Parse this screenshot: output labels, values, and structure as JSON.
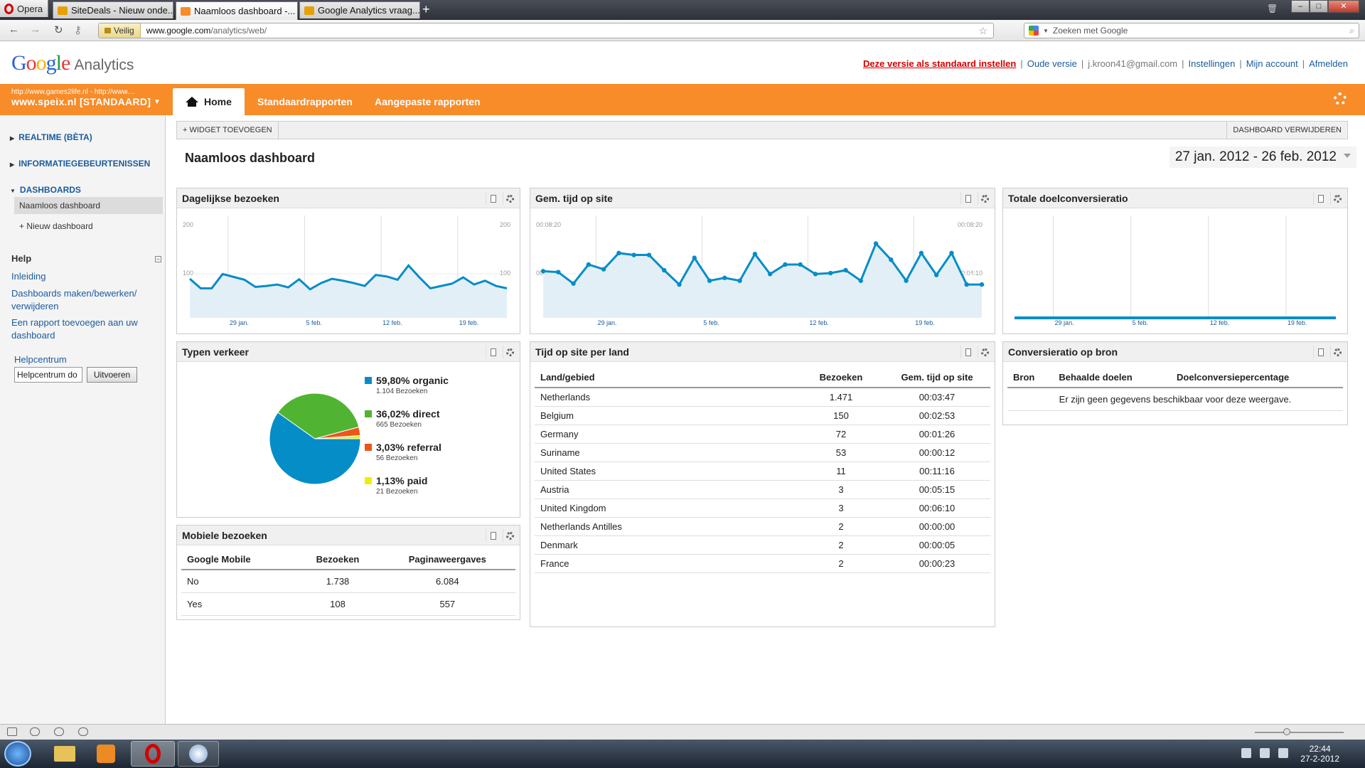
{
  "browser": {
    "menu_label": "Opera",
    "tabs": [
      {
        "label": "SiteDeals - Nieuw onde...",
        "favicon_color": "#e8a000"
      },
      {
        "label": "Naamloos dashboard -...",
        "favicon_color": "#f78c29"
      },
      {
        "label": "Google Analytics vraag...",
        "favicon_color": "#e8a000"
      }
    ],
    "secure_label": "Veilig",
    "url_prefix": "www.google.com",
    "url_path": "/analytics/web/",
    "search_placeholder": "Zoeken met Google"
  },
  "header": {
    "logo_google": "Google",
    "logo_analytics": "Analytics",
    "links": {
      "default_version": "Deze versie als standaard instellen",
      "old_version": "Oude versie",
      "email": "j.kroon41@gmail.com",
      "settings": "Instellingen",
      "account": "Mijn account",
      "logout": "Afmelden"
    }
  },
  "account": {
    "small": "http://www.games2life.nl - http://www....",
    "name": "www.speix.nl [STANDAARD]"
  },
  "nav": {
    "home": "Home",
    "standard_reports": "Standaardrapporten",
    "custom_reports": "Aangepaste rapporten"
  },
  "sidebar": {
    "realtime": "REALTIME (BÈTA)",
    "info_events": "INFORMATIEGEBEURTENISSEN",
    "dashboards": "DASHBOARDS",
    "current_dashboard": "Naamloos dashboard",
    "new_dashboard": "+ Nieuw dashboard",
    "help": "Help",
    "help_links": [
      "Inleiding",
      "Dashboards maken/bewerken/ verwijderen",
      "Een rapport toevoegen aan uw dashboard"
    ],
    "helpcenter_label": "Helpcentrum",
    "helpcenter_input": "Helpcentrum do",
    "helpcenter_button": "Uitvoeren"
  },
  "toolbar": {
    "add_widget": "+ WIDGET TOEVOEGEN",
    "delete_dashboard": "DASHBOARD VERWIJDEREN"
  },
  "dashboard": {
    "title": "Naamloos dashboard",
    "date_range": "27 jan. 2012 - 26 feb. 2012"
  },
  "widgets": {
    "daily_visits": {
      "title": "Dagelijkse bezoeken",
      "ytick_top": "200",
      "ytick_mid": "100"
    },
    "avg_time": {
      "title": "Gem. tijd op site",
      "ytick_top": "00:08:20",
      "ytick_mid": "00:04:10"
    },
    "goal_conv": {
      "title": "Totale doelconversieratio"
    },
    "traffic": {
      "title": "Typen verkeer",
      "items": [
        {
          "pct": "59,80% organic",
          "sub": "1.104 Bezoeken"
        },
        {
          "pct": "36,02% direct",
          "sub": "665 Bezoeken"
        },
        {
          "pct": "3,03% referral",
          "sub": "56 Bezoeken"
        },
        {
          "pct": "1,13% paid",
          "sub": "21 Bezoeken"
        }
      ]
    },
    "mobile": {
      "title": "Mobiele bezoeken",
      "headers": [
        "Google Mobile",
        "Bezoeken",
        "Paginaweergaves"
      ],
      "rows": [
        [
          "No",
          "1.738",
          "6.084"
        ],
        [
          "Yes",
          "108",
          "557"
        ]
      ]
    },
    "country": {
      "title": "Tijd op site per land",
      "headers": [
        "Land/gebied",
        "Bezoeken",
        "Gem. tijd op site"
      ],
      "rows": [
        [
          "Netherlands",
          "1.471",
          "00:03:47"
        ],
        [
          "Belgium",
          "150",
          "00:02:53"
        ],
        [
          "Germany",
          "72",
          "00:01:26"
        ],
        [
          "Suriname",
          "53",
          "00:00:12"
        ],
        [
          "United States",
          "11",
          "00:11:16"
        ],
        [
          "Austria",
          "3",
          "00:05:15"
        ],
        [
          "United Kingdom",
          "3",
          "00:06:10"
        ],
        [
          "Netherlands Antilles",
          "2",
          "00:00:00"
        ],
        [
          "Denmark",
          "2",
          "00:00:05"
        ],
        [
          "France",
          "2",
          "00:00:23"
        ]
      ]
    },
    "conv_source": {
      "title": "Conversieratio op bron",
      "headers": [
        "Bron",
        "Behaalde doelen",
        "Doelconversiepercentage"
      ],
      "empty": "Er zijn geen gegevens beschikbaar voor deze weergave."
    }
  },
  "colors": {
    "accent": "#f78c29",
    "line": "#058dc7",
    "organic": "#058dc7",
    "direct": "#50b432",
    "referral": "#ed561b",
    "paid": "#edef00"
  },
  "chart_data": [
    {
      "type": "line",
      "title": "Dagelijkse bezoeken",
      "x_ticks": [
        "29 jan.",
        "5 feb.",
        "12 feb.",
        "19 feb."
      ],
      "ylim": [
        0,
        200
      ],
      "values": [
        82,
        62,
        62,
        92,
        86,
        80,
        65,
        67,
        70,
        64,
        81,
        60,
        73,
        82,
        78,
        73,
        67,
        90,
        87,
        80,
        110,
        85,
        62,
        67,
        72,
        85,
        70,
        78,
        67,
        62
      ]
    },
    {
      "type": "line",
      "title": "Gem. tijd op site",
      "x_ticks": [
        "29 jan.",
        "5 feb.",
        "12 feb.",
        "19 feb."
      ],
      "ylim": [
        0,
        500
      ],
      "y_unit": "seconds",
      "values": [
        245,
        240,
        180,
        280,
        255,
        340,
        330,
        330,
        250,
        175,
        315,
        195,
        210,
        195,
        335,
        230,
        280,
        280,
        230,
        235,
        250,
        195,
        390,
        305,
        195,
        340,
        225,
        340,
        175,
        175
      ]
    },
    {
      "type": "line",
      "title": "Totale doelconversieratio",
      "x_ticks": [
        "29 jan.",
        "5 feb.",
        "12 feb.",
        "19 feb."
      ],
      "values": [
        0,
        0,
        0,
        0,
        0,
        0,
        0,
        0,
        0,
        0,
        0,
        0,
        0,
        0,
        0,
        0,
        0,
        0,
        0,
        0,
        0,
        0,
        0,
        0,
        0,
        0,
        0,
        0,
        0,
        0
      ]
    },
    {
      "type": "pie",
      "title": "Typen verkeer",
      "labels": [
        "organic",
        "direct",
        "referral",
        "paid"
      ],
      "values": [
        59.8,
        36.02,
        3.03,
        1.13
      ],
      "visits": [
        1104,
        665,
        56,
        21
      ]
    }
  ],
  "taskbar": {
    "time": "22:44",
    "date": "27-2-2012"
  }
}
